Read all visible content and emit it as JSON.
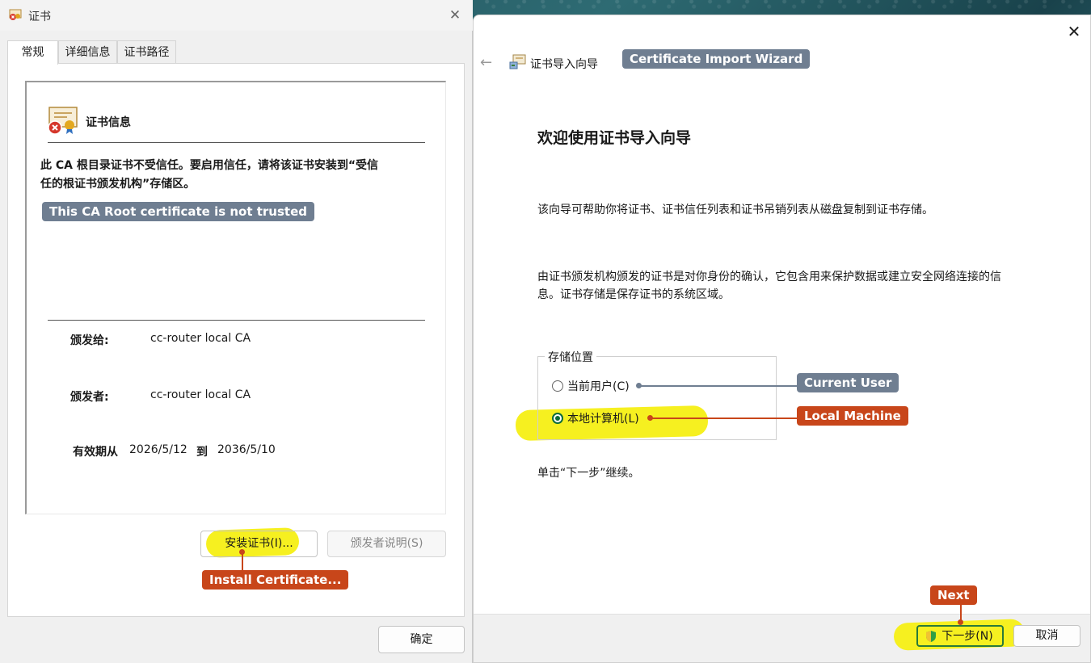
{
  "cert_dialog": {
    "title": "证书",
    "close_glyph": "✕",
    "tabs": [
      "常规",
      "详细信息",
      "证书路径"
    ],
    "info_title": "证书信息",
    "warning_line1": "此 CA 根目录证书不受信任。要启用信任，请将该证书安装到“受信",
    "warning_line2": "任的根证书颁发机构”存储区。",
    "issued_to_label": "颁发给:",
    "issued_to_value": "cc-router local CA",
    "issued_by_label": "颁发者:",
    "issued_by_value": "cc-router local CA",
    "valid_from_label": "有效期从",
    "valid_from": "2026/5/12",
    "valid_to_label": "到",
    "valid_to": "2036/5/10",
    "install_button": "安装证书(I)...",
    "issuer_statement_button": "颁发者说明(S)",
    "ok_button": "确定"
  },
  "wizard": {
    "close_glyph": "✕",
    "back_glyph": "←",
    "header_title": "证书导入向导",
    "heading": "欢迎使用证书导入向导",
    "para1": "该向导可帮助你将证书、证书信任列表和证书吊销列表从磁盘复制到证书存储。",
    "para2_line1": "由证书颁发机构颁发的证书是对你身份的确认，它包含用来保护数据或建立安全网络连接的信",
    "para2_line2": "息。证书存储是保存证书的系统区域。",
    "store_legend": "存储位置",
    "option_current_user": "当前用户(C)",
    "option_local_machine": "本地计算机(L)",
    "selected_option": "本地计算机(L)",
    "continue_hint": "单击“下一步”继续。",
    "next_button": "下一步(N)",
    "cancel_button": "取消"
  },
  "annotations": {
    "wizard_label": "Certificate Import Wizard",
    "not_trusted": "This CA Root certificate is not trusted",
    "current_user": "Current User",
    "local_machine": "Local Machine",
    "install_certificate": "Install Certificate...",
    "next": "Next"
  },
  "colors": {
    "annotation_gray": "#6f7e91",
    "annotation_orange": "#c8461a",
    "highlight_yellow": "#f6ef14",
    "radio_selected": "#0c6b3a"
  }
}
